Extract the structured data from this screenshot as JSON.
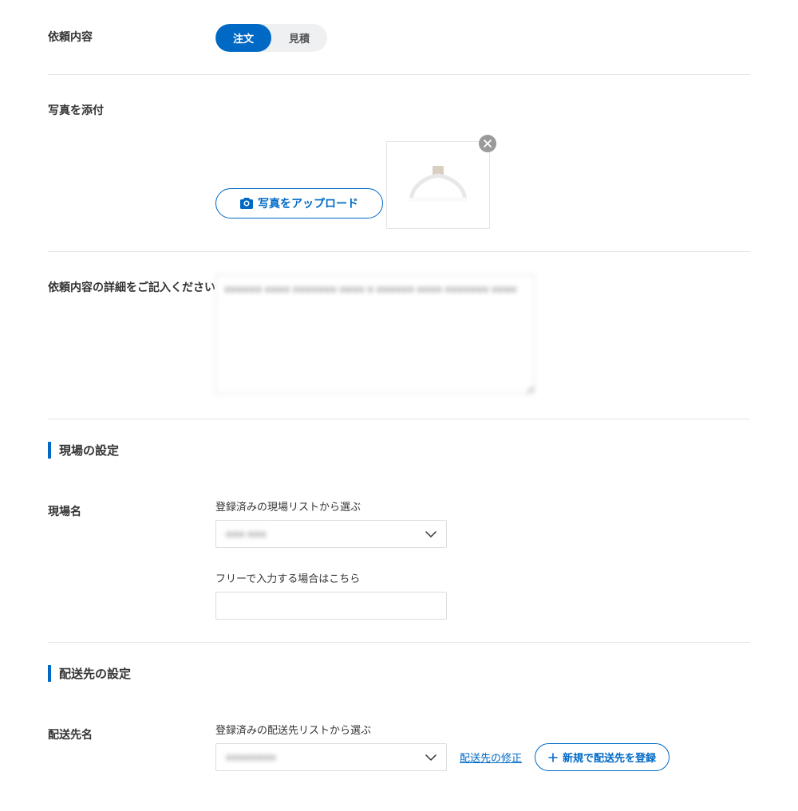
{
  "request": {
    "label": "依頼内容",
    "options": {
      "order": "注文",
      "quote": "見積"
    }
  },
  "attach": {
    "label": "写真を添付",
    "upload_button": "写真をアップロード"
  },
  "details": {
    "label": "依頼内容の詳細をご記入ください",
    "value": "■■■■■■ ■■■■ ■■■■■■■ ■■■■ ■ ■■■■■■ ■■■■ ■■■■■■■ ■■■■"
  },
  "site": {
    "section_title": "現場の設定",
    "name_label": "現場名",
    "list_label": "登録済みの現場リストから選ぶ",
    "selected": "■■■ ■■■",
    "free_label": "フリーで入力する場合はこちら"
  },
  "delivery": {
    "section_title": "配送先の設定",
    "name_label": "配送先名",
    "list_label": "登録済みの配送先リストから選ぶ",
    "selected": "■■■■■■■■",
    "edit_link": "配送先の修正",
    "add_button": "新規で配送先を登録"
  }
}
